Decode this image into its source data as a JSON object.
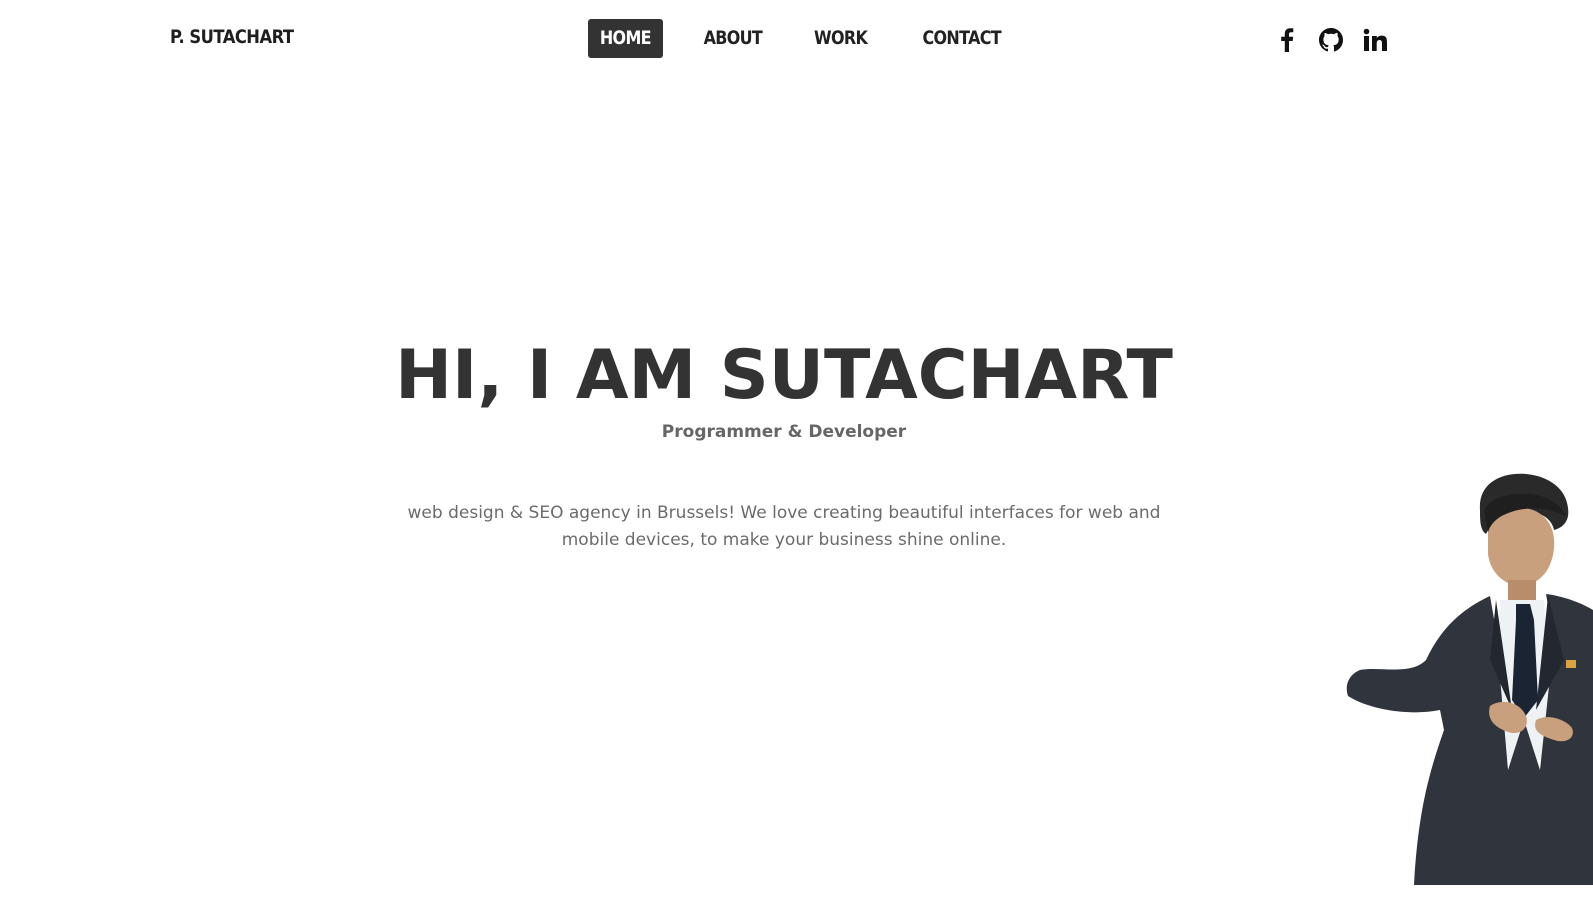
{
  "header": {
    "brand": "P. SUTACHART",
    "nav": [
      {
        "label": "HOME",
        "active": true
      },
      {
        "label": "ABOUT",
        "active": false
      },
      {
        "label": "WORK",
        "active": false
      },
      {
        "label": "CONTACT",
        "active": false
      }
    ],
    "social": [
      {
        "icon": "facebook-icon"
      },
      {
        "icon": "github-icon"
      },
      {
        "icon": "linkedin-icon"
      }
    ]
  },
  "hero": {
    "title": "HI, I AM SUTACHART",
    "subtitle": "Programmer & Developer",
    "description": "web design & SEO agency in Brussels! We love creating beautiful interfaces for web and mobile devices, to make your business shine online."
  },
  "colors": {
    "text_dark": "#333333",
    "text_muted": "#6b6b6b",
    "nav_active_bg": "#333333",
    "nav_active_text": "#ffffff",
    "background": "#ffffff"
  }
}
